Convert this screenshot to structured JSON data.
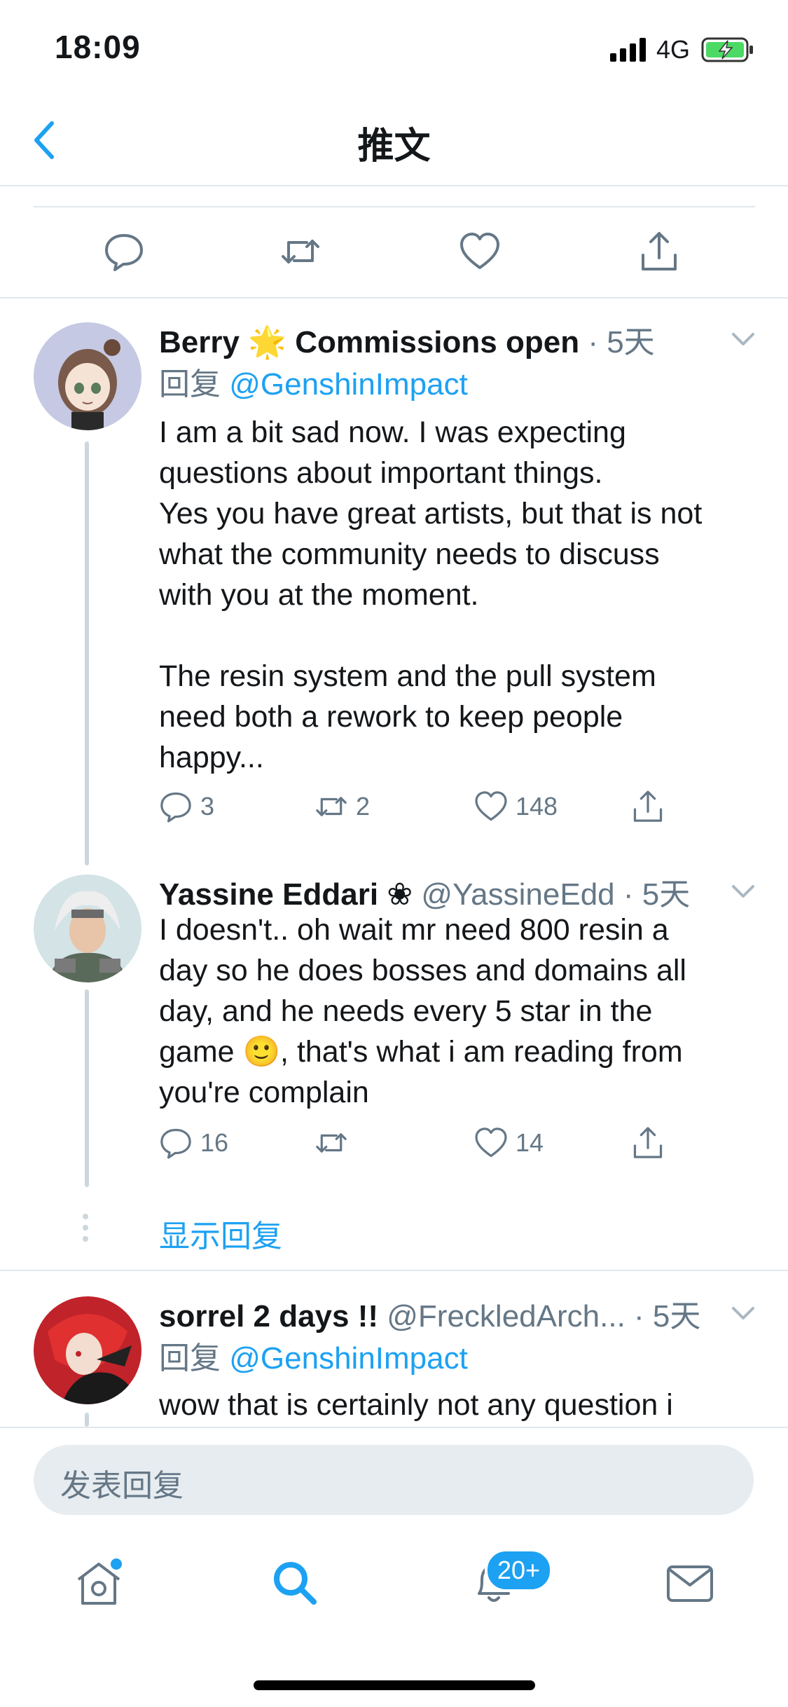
{
  "status_bar": {
    "time": "18:09",
    "network": "4G"
  },
  "nav": {
    "title": "推文"
  },
  "colors": {
    "accent": "#1da1f2",
    "muted": "#657786",
    "border": "#e1e8ed",
    "battery": "#4cd964"
  },
  "replies": [
    {
      "name": "Berry",
      "name_emoji": "🌟",
      "name_suffix": "Commissions open",
      "time": "· 5天",
      "reply_prefix": "回复",
      "reply_to": "@GenshinImpact",
      "text_lines": [
        "I am a bit sad now. I was expecting",
        "questions about important things.",
        "Yes you have great artists, but that is not",
        "what the community needs to discuss",
        "with you at the moment.",
        "",
        "The resin system and the pull system",
        "need both a rework to keep people",
        "happy..."
      ],
      "reply_count": "3",
      "retweet_count": "2",
      "like_count": "148"
    },
    {
      "name": "Yassine Eddari",
      "name_symbol": "❀",
      "handle": "@YassineEdd",
      "time": "· 5天",
      "text_lines": [
        "I doesn't.. oh wait mr need 800 resin a",
        "day so he does bosses and domains all",
        "day, and he needs every 5 star in the",
        "game 🙂, that's what i am reading from",
        "you're complain"
      ],
      "reply_count": "16",
      "retweet_count": "",
      "like_count": "14"
    },
    {
      "name": "sorrel 2 days !!",
      "handle": "@FreckledArch...",
      "time": "· 5天",
      "reply_prefix": "回复",
      "reply_to": "@GenshinImpact",
      "text_lines": [
        "wow that is certainly not any question i"
      ]
    }
  ],
  "show_replies_label": "显示回复",
  "compose": {
    "placeholder": "发表回复"
  },
  "tabbar": {
    "notifications_badge": "20+"
  },
  "icons": [
    "back-chevron-icon",
    "reply-icon",
    "retweet-icon",
    "like-icon",
    "share-icon",
    "chevron-down-icon",
    "home-icon",
    "search-icon",
    "notifications-icon",
    "messages-icon",
    "signal-icon",
    "battery-icon"
  ]
}
